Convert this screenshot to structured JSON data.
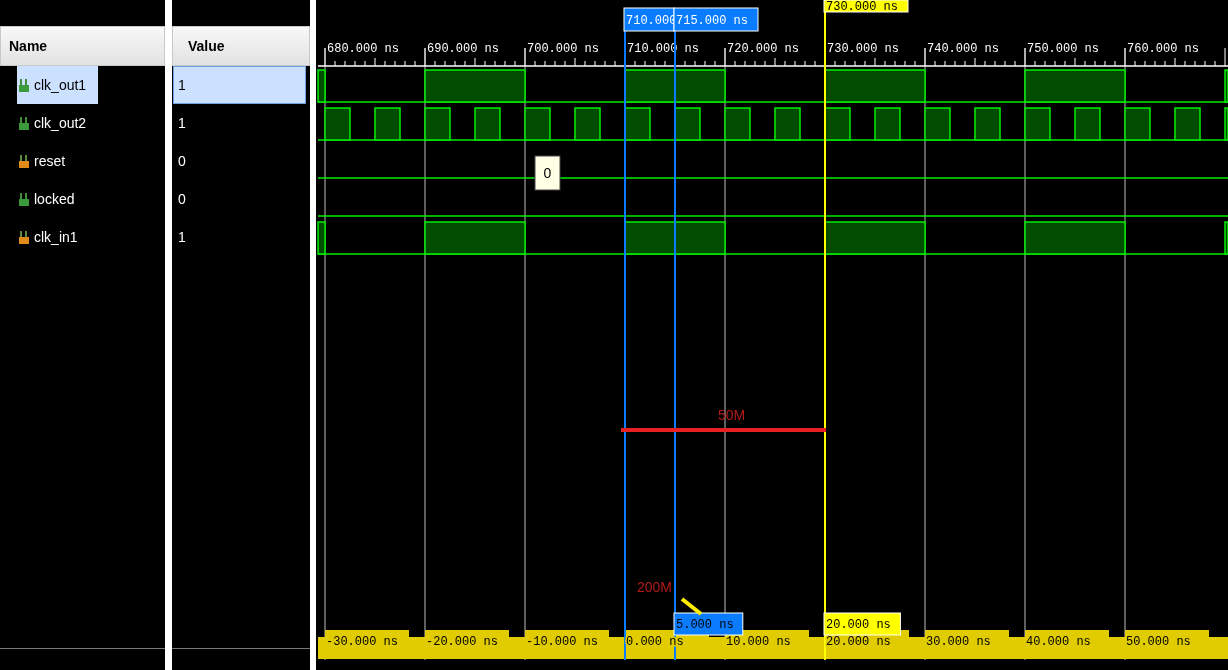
{
  "columns": {
    "name": "Name",
    "value": "Value"
  },
  "signals": [
    {
      "name": "clk_out1",
      "value": "1",
      "kind": "output",
      "selected": true,
      "wave": {
        "kind": "slowclock"
      }
    },
    {
      "name": "clk_out2",
      "value": "1",
      "kind": "output",
      "selected": false,
      "wave": {
        "kind": "fastclock"
      }
    },
    {
      "name": "reset",
      "value": "0",
      "kind": "input",
      "selected": false,
      "wave": {
        "kind": "low"
      }
    },
    {
      "name": "locked",
      "value": "0",
      "kind": "output",
      "selected": false,
      "wave": {
        "kind": "low"
      }
    },
    {
      "name": "clk_in1",
      "value": "1",
      "kind": "input",
      "selected": false,
      "wave": {
        "kind": "slowclock"
      }
    }
  ],
  "time_ruler": [
    "680.000 ns",
    "690.000 ns",
    "700.000 ns",
    "710.000 ns",
    "720.000 ns",
    "730.000 ns",
    "740.000 ns",
    "750.000 ns",
    "760.000 ns"
  ],
  "delta_ruler": [
    "-30.000 ns",
    "-20.000 ns",
    "-10.000 ns",
    "0.000 ns",
    "10.000 ns",
    "20.000 ns",
    "30.000 ns",
    "40.000 ns",
    "50.000 ns"
  ],
  "cursors": [
    {
      "kind": "marker",
      "label": "710.000"
    },
    {
      "kind": "marker",
      "label": "715.000 ns",
      "delta": "5.000 ns"
    },
    {
      "kind": "main",
      "label": "730.000 ns",
      "delta": "20.000 ns"
    }
  ],
  "tooltip": "0",
  "annotations": [
    {
      "kind": "span",
      "text": "50M"
    },
    {
      "kind": "pointer",
      "text": "200M"
    }
  ]
}
